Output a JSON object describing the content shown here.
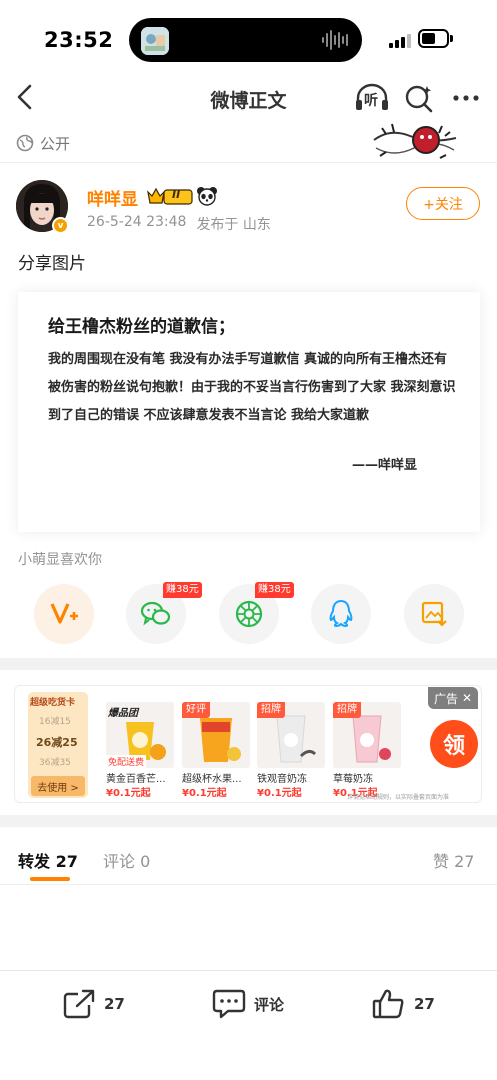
{
  "status": {
    "time": "23:52"
  },
  "nav": {
    "title": "微博正文",
    "listen_label": "听"
  },
  "post": {
    "visibility": "公开",
    "author": {
      "name": "咩咩显",
      "rank_label": "II",
      "verified_label": "v"
    },
    "date": "26-5-24 23:48",
    "location": "发布于 山东",
    "follow_label": "+关注",
    "text": "分享图片"
  },
  "image_card": {
    "title": "给王橹杰粉丝的道歉信；",
    "body": "我的周围现在没有笔 我没有办法手写道歉信 真诚的向所有王橹杰还有被伤害的粉丝说句抱歉！由于我的不妥当言行伤害到了大家 我深刻意识到了自己的错误 不应该肆意发表不当言论 我给大家道歉",
    "signature": "——咩咩显"
  },
  "liked_by": "小萌显喜欢你",
  "share": {
    "earn_wechat": "赚38元",
    "earn_moments": "赚38元"
  },
  "ad": {
    "badge": "广告",
    "coupon": {
      "header": "超级吃货卡",
      "line1": "16减15",
      "line2": "26减25",
      "line3": "36减35",
      "button": "去使用 >"
    },
    "products": [
      {
        "tag": "",
        "logo": "爆品团",
        "sub": "免配送费",
        "name": "黄金百香芒...",
        "price": "¥0.1元起"
      },
      {
        "tag": "好评",
        "logo": "",
        "sub": "",
        "name": "超级杯水果...",
        "price": "¥0.1元起"
      },
      {
        "tag": "招牌",
        "logo": "",
        "sub": "",
        "name": "铁观音奶冻",
        "price": "¥0.1元起"
      },
      {
        "tag": "招牌",
        "logo": "",
        "sub": "",
        "name": "草莓奶冻",
        "price": "¥0.1元起"
      }
    ],
    "claim": "领",
    "footnote": "详情见活动规则，以实际叠套页面为准"
  },
  "tabs": {
    "repost_label": "转发",
    "repost_count": "27",
    "comment_label": "评论",
    "comment_count": "0",
    "like_label": "赞",
    "like_count": "27"
  },
  "bottom": {
    "repost_count": "27",
    "comment_label": "评论",
    "like_count": "27"
  },
  "colors": {
    "accent": "#ff8200",
    "red": "#ff3b30",
    "text": "#222222",
    "muted": "#939393"
  }
}
